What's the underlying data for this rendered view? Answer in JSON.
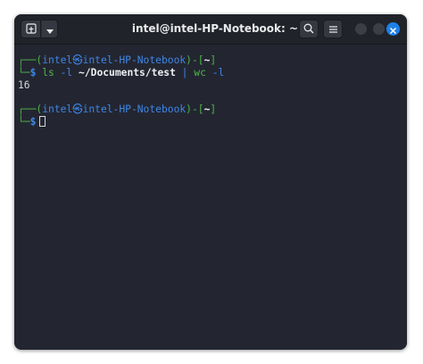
{
  "window": {
    "title": "intel@intel-HP-Notebook: ~"
  },
  "icons": {
    "new_tab": "new-tab-icon",
    "dropdown": "chevron-down-icon",
    "search": "search-icon",
    "menu": "hamburger-menu-icon",
    "close": "close-icon"
  },
  "colors": {
    "accent": "#1f80e6",
    "prompt_frame": "#4fb548",
    "prompt_user": "#3d86e8",
    "terminal_bg": "#232631"
  },
  "terminal": {
    "prompt1": {
      "corner": "┌──(",
      "user": "intel",
      "at": "㉿",
      "host": "intel-HP-Notebook",
      "mid": ")-[",
      "dir": "~",
      "end": "]"
    },
    "command1": {
      "corner": "└─",
      "dollar": "$ ",
      "cmd": "ls",
      "arg1": " -l ",
      "path": "~/Documents/test",
      "pipe": " | ",
      "cmd2": "wc",
      "arg2": " -l"
    },
    "output": "16",
    "prompt2": {
      "corner": "┌──(",
      "user": "intel",
      "at": "㉿",
      "host": "intel-HP-Notebook",
      "mid": ")-[",
      "dir": "~",
      "end": "]"
    },
    "command2": {
      "corner": "└─",
      "dollar": "$"
    }
  }
}
